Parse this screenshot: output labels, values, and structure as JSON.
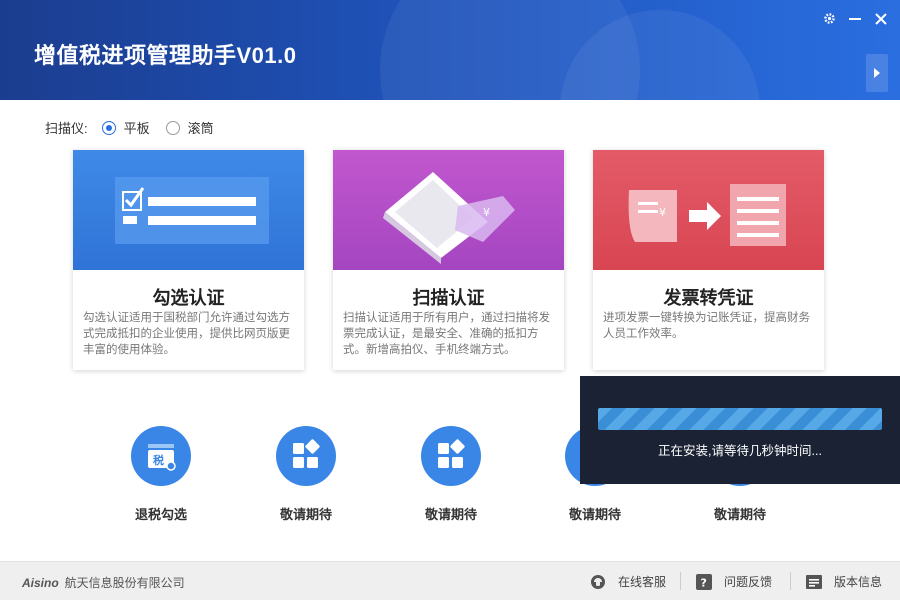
{
  "header": {
    "title": "增值税进项管理助手V01.0",
    "settings_icon": "gear-icon",
    "minimize_icon": "minimize-icon",
    "close_icon": "close-icon",
    "expand_icon": "chevron-right-icon"
  },
  "scanner": {
    "label": "扫描仪:",
    "options": [
      {
        "label": "平板",
        "selected": true
      },
      {
        "label": "滚筒",
        "selected": false
      }
    ]
  },
  "cards": [
    {
      "title": "勾选认证",
      "desc": "勾选认证适用于国税部门允许通过勾选方式完成抵扣的企业使用，提供比网页版更丰富的使用体验。",
      "color": "#3a82e0"
    },
    {
      "title": "扫描认证",
      "desc": "扫描认证适用于所有用户，通过扫描将发票完成认证，是最安全、准确的抵扣方式。新增高拍仪、手机终端方式。",
      "color": "#b04fc9"
    },
    {
      "title": "发票转凭证",
      "desc": "进项发票一键转换为记账凭证，提高财务人员工作效率。",
      "color": "#e0505e"
    }
  ],
  "features": [
    {
      "label": "退税勾选",
      "icon": "tax-refund-icon",
      "badge": "税"
    },
    {
      "label": "敬请期待",
      "icon": "apps-grid-icon"
    },
    {
      "label": "敬请期待",
      "icon": "apps-grid-icon"
    },
    {
      "label": "敬请期待",
      "icon": "apps-grid-icon"
    },
    {
      "label": "敬请期待",
      "icon": "apps-grid-icon"
    }
  ],
  "install": {
    "message": "正在安装,请等待几秒钟时间...",
    "progress": 1.0
  },
  "footer": {
    "brand_logo": "Aisino",
    "company": "航天信息股份有限公司",
    "links": [
      {
        "label": "在线客服",
        "icon": "headset-icon"
      },
      {
        "label": "问题反馈",
        "icon": "question-icon"
      },
      {
        "label": "版本信息",
        "icon": "info-card-icon"
      }
    ]
  },
  "colors": {
    "accent": "#2a6ee0",
    "overlay": "#1a2233"
  }
}
